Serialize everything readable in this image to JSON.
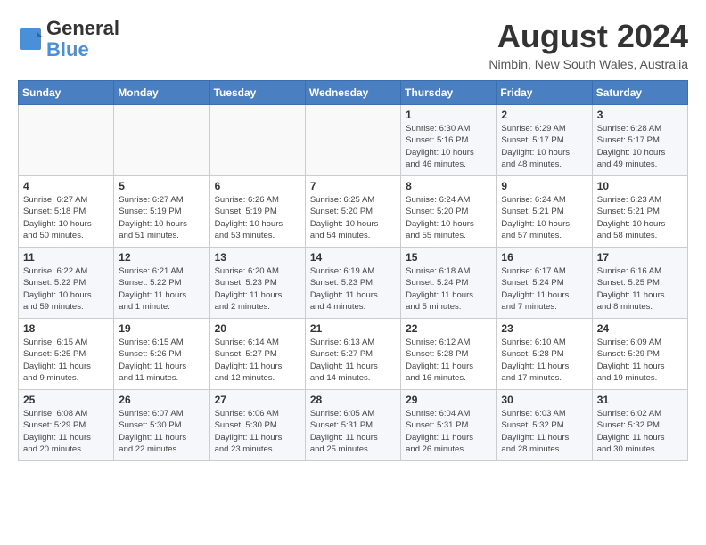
{
  "header": {
    "logo_line1": "General",
    "logo_line2": "Blue",
    "month_year": "August 2024",
    "location": "Nimbin, New South Wales, Australia"
  },
  "days_of_week": [
    "Sunday",
    "Monday",
    "Tuesday",
    "Wednesday",
    "Thursday",
    "Friday",
    "Saturday"
  ],
  "weeks": [
    [
      {
        "day": "",
        "info": ""
      },
      {
        "day": "",
        "info": ""
      },
      {
        "day": "",
        "info": ""
      },
      {
        "day": "",
        "info": ""
      },
      {
        "day": "1",
        "info": "Sunrise: 6:30 AM\nSunset: 5:16 PM\nDaylight: 10 hours\nand 46 minutes."
      },
      {
        "day": "2",
        "info": "Sunrise: 6:29 AM\nSunset: 5:17 PM\nDaylight: 10 hours\nand 48 minutes."
      },
      {
        "day": "3",
        "info": "Sunrise: 6:28 AM\nSunset: 5:17 PM\nDaylight: 10 hours\nand 49 minutes."
      }
    ],
    [
      {
        "day": "4",
        "info": "Sunrise: 6:27 AM\nSunset: 5:18 PM\nDaylight: 10 hours\nand 50 minutes."
      },
      {
        "day": "5",
        "info": "Sunrise: 6:27 AM\nSunset: 5:19 PM\nDaylight: 10 hours\nand 51 minutes."
      },
      {
        "day": "6",
        "info": "Sunrise: 6:26 AM\nSunset: 5:19 PM\nDaylight: 10 hours\nand 53 minutes."
      },
      {
        "day": "7",
        "info": "Sunrise: 6:25 AM\nSunset: 5:20 PM\nDaylight: 10 hours\nand 54 minutes."
      },
      {
        "day": "8",
        "info": "Sunrise: 6:24 AM\nSunset: 5:20 PM\nDaylight: 10 hours\nand 55 minutes."
      },
      {
        "day": "9",
        "info": "Sunrise: 6:24 AM\nSunset: 5:21 PM\nDaylight: 10 hours\nand 57 minutes."
      },
      {
        "day": "10",
        "info": "Sunrise: 6:23 AM\nSunset: 5:21 PM\nDaylight: 10 hours\nand 58 minutes."
      }
    ],
    [
      {
        "day": "11",
        "info": "Sunrise: 6:22 AM\nSunset: 5:22 PM\nDaylight: 10 hours\nand 59 minutes."
      },
      {
        "day": "12",
        "info": "Sunrise: 6:21 AM\nSunset: 5:22 PM\nDaylight: 11 hours\nand 1 minute."
      },
      {
        "day": "13",
        "info": "Sunrise: 6:20 AM\nSunset: 5:23 PM\nDaylight: 11 hours\nand 2 minutes."
      },
      {
        "day": "14",
        "info": "Sunrise: 6:19 AM\nSunset: 5:23 PM\nDaylight: 11 hours\nand 4 minutes."
      },
      {
        "day": "15",
        "info": "Sunrise: 6:18 AM\nSunset: 5:24 PM\nDaylight: 11 hours\nand 5 minutes."
      },
      {
        "day": "16",
        "info": "Sunrise: 6:17 AM\nSunset: 5:24 PM\nDaylight: 11 hours\nand 7 minutes."
      },
      {
        "day": "17",
        "info": "Sunrise: 6:16 AM\nSunset: 5:25 PM\nDaylight: 11 hours\nand 8 minutes."
      }
    ],
    [
      {
        "day": "18",
        "info": "Sunrise: 6:15 AM\nSunset: 5:25 PM\nDaylight: 11 hours\nand 9 minutes."
      },
      {
        "day": "19",
        "info": "Sunrise: 6:15 AM\nSunset: 5:26 PM\nDaylight: 11 hours\nand 11 minutes."
      },
      {
        "day": "20",
        "info": "Sunrise: 6:14 AM\nSunset: 5:27 PM\nDaylight: 11 hours\nand 12 minutes."
      },
      {
        "day": "21",
        "info": "Sunrise: 6:13 AM\nSunset: 5:27 PM\nDaylight: 11 hours\nand 14 minutes."
      },
      {
        "day": "22",
        "info": "Sunrise: 6:12 AM\nSunset: 5:28 PM\nDaylight: 11 hours\nand 16 minutes."
      },
      {
        "day": "23",
        "info": "Sunrise: 6:10 AM\nSunset: 5:28 PM\nDaylight: 11 hours\nand 17 minutes."
      },
      {
        "day": "24",
        "info": "Sunrise: 6:09 AM\nSunset: 5:29 PM\nDaylight: 11 hours\nand 19 minutes."
      }
    ],
    [
      {
        "day": "25",
        "info": "Sunrise: 6:08 AM\nSunset: 5:29 PM\nDaylight: 11 hours\nand 20 minutes."
      },
      {
        "day": "26",
        "info": "Sunrise: 6:07 AM\nSunset: 5:30 PM\nDaylight: 11 hours\nand 22 minutes."
      },
      {
        "day": "27",
        "info": "Sunrise: 6:06 AM\nSunset: 5:30 PM\nDaylight: 11 hours\nand 23 minutes."
      },
      {
        "day": "28",
        "info": "Sunrise: 6:05 AM\nSunset: 5:31 PM\nDaylight: 11 hours\nand 25 minutes."
      },
      {
        "day": "29",
        "info": "Sunrise: 6:04 AM\nSunset: 5:31 PM\nDaylight: 11 hours\nand 26 minutes."
      },
      {
        "day": "30",
        "info": "Sunrise: 6:03 AM\nSunset: 5:32 PM\nDaylight: 11 hours\nand 28 minutes."
      },
      {
        "day": "31",
        "info": "Sunrise: 6:02 AM\nSunset: 5:32 PM\nDaylight: 11 hours\nand 30 minutes."
      }
    ]
  ]
}
